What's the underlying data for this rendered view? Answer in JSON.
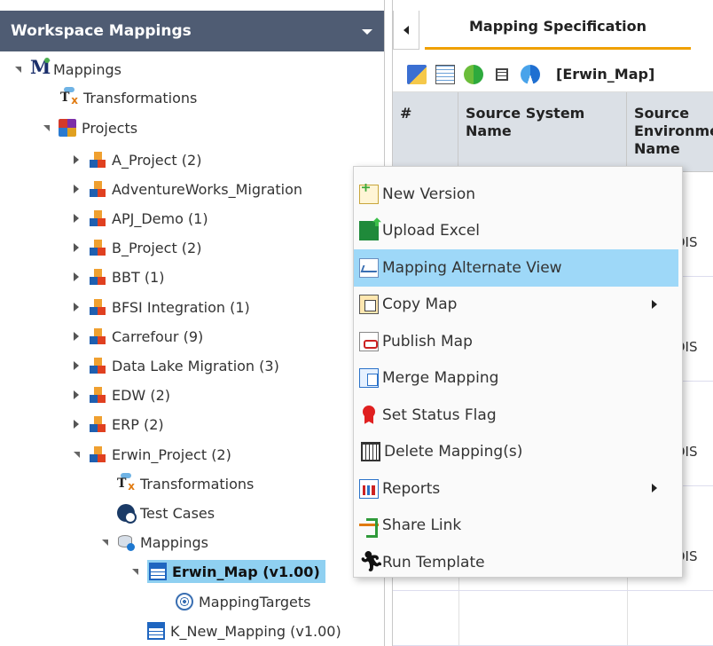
{
  "left_panel": {
    "header": "Workspace Mappings",
    "tree": [
      {
        "label": "Mappings",
        "icon": "mappings-root-icon"
      },
      {
        "label": "Transformations",
        "icon": "transformations-icon"
      },
      {
        "label": "Projects",
        "icon": "projects-icon"
      },
      {
        "label": "A_Project (2)",
        "icon": "project-icon"
      },
      {
        "label": "AdventureWorks_Migration",
        "icon": "project-icon"
      },
      {
        "label": "APJ_Demo (1)",
        "icon": "project-icon"
      },
      {
        "label": "B_Project (2)",
        "icon": "project-icon"
      },
      {
        "label": "BBT (1)",
        "icon": "project-icon"
      },
      {
        "label": "BFSI Integration (1)",
        "icon": "project-icon"
      },
      {
        "label": "Carrefour (9)",
        "icon": "project-icon"
      },
      {
        "label": "Data Lake Migration (3)",
        "icon": "project-icon"
      },
      {
        "label": "EDW (2)",
        "icon": "project-icon"
      },
      {
        "label": "ERP (2)",
        "icon": "project-icon"
      },
      {
        "label": "Erwin_Project (2)",
        "icon": "project-icon"
      },
      {
        "label": "Transformations",
        "icon": "transformations-icon"
      },
      {
        "label": "Test Cases",
        "icon": "test-cases-icon"
      },
      {
        "label": "Mappings",
        "icon": "mappings-folder-icon"
      },
      {
        "label": "Erwin_Map (v1.00)",
        "icon": "mapping-table-icon"
      },
      {
        "label": "MappingTargets",
        "icon": "target-icon"
      },
      {
        "label": "K_New_Mapping (v1.00)",
        "icon": "mapping-table-icon"
      }
    ]
  },
  "right_panel": {
    "tab_label": "Mapping Specification",
    "map_name": "[Erwin_Map]",
    "columns": [
      "#",
      "Source System Name",
      "Source Environment Name"
    ],
    "cell_fragment": "DIS"
  },
  "context_menu": {
    "items": [
      {
        "label": "New Version",
        "icon": "new-version-icon",
        "submenu": false
      },
      {
        "label": "Upload Excel",
        "icon": "excel-upload-icon",
        "submenu": false
      },
      {
        "label": "Mapping Alternate View",
        "icon": "alternate-view-icon",
        "submenu": false,
        "highlighted": true
      },
      {
        "label": "Copy Map",
        "icon": "copy-map-icon",
        "submenu": true
      },
      {
        "label": "Publish Map",
        "icon": "publish-map-icon",
        "submenu": false
      },
      {
        "label": "Merge Mapping",
        "icon": "merge-mapping-icon",
        "submenu": false
      },
      {
        "label": "Set Status Flag",
        "icon": "status-flag-icon",
        "submenu": false
      },
      {
        "label": "Delete Mapping(s)",
        "icon": "trash-icon",
        "submenu": false
      },
      {
        "label": "Reports",
        "icon": "reports-icon",
        "submenu": true
      },
      {
        "label": "Share Link",
        "icon": "share-link-icon",
        "submenu": false
      },
      {
        "label": "Run Template",
        "icon": "run-icon",
        "submenu": false
      }
    ]
  },
  "colors": {
    "header_bg": "#4f5c73",
    "selection": "#8fd0f1",
    "menu_highlight": "#9ed8f8",
    "tab_underline": "#f0a000",
    "grid_header_bg": "#dbe0e6"
  }
}
